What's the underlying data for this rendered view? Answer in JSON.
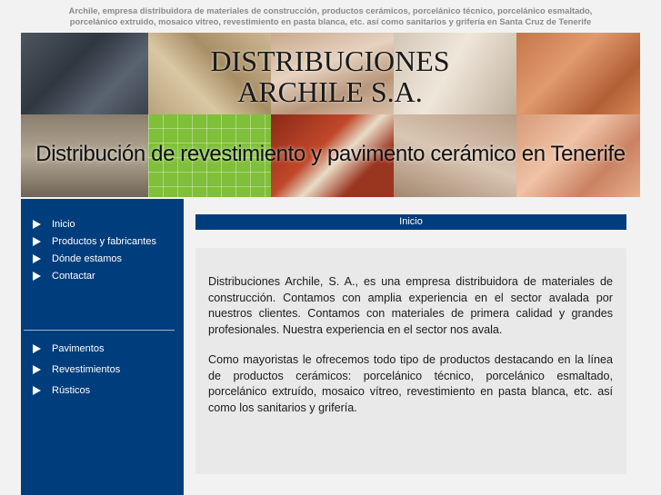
{
  "top_text": {
    "line1": "Archile, empresa distribuidora de materiales de construcción, productos cerámicos, porcelánico técnico, porcelánico esmaltado,",
    "line2": "porcelánico extruido, mosaico vitreo, revestimiento en pasta blanca, etc. así como sanitarios y grifería en Santa Cruz de Tenerife"
  },
  "banner": {
    "title_line1": "DISTRIBUCIONES",
    "title_line2": "ARCHILE S.A.",
    "subtitle": "Distribución de revestimiento y pavimento cerámico en Tenerife"
  },
  "sidebar": {
    "menu1": [
      {
        "label": "Inicio",
        "icon": "arrow-right-icon"
      },
      {
        "label": "Productos y fabricantes",
        "icon": "arrow-right-icon"
      },
      {
        "label": "Dónde estamos",
        "icon": "arrow-right-icon"
      },
      {
        "label": "Contactar",
        "icon": "arrow-right-icon"
      }
    ],
    "menu2": [
      {
        "label": "Pavimentos",
        "icon": "arrow-right-icon"
      },
      {
        "label": "Revestimientos",
        "icon": "arrow-right-icon"
      },
      {
        "label": "Rústicos",
        "icon": "arrow-right-icon"
      }
    ]
  },
  "main": {
    "header": "Inicio",
    "paragraph1": "Distribuciones Archile, S. A., es una empresa distribuidora de materiales de construcción. Contamos con amplia experiencia en el sector avalada por nuestros clientes. Contamos con materiales de primera calidad y grandes profesionales. Nuestra experiencia en el sector nos avala.",
    "paragraph2": "Como mayoristas le ofrecemos todo tipo de productos destacando en la línea de productos cerámicos: porcelánico técnico, porcelánico esmaltado, porcelánico extruído, mosaico vítreo,   revestimiento en pasta blanca, etc. así como los sanitarios y grifería."
  },
  "colors": {
    "nav_blue": "#003d7c",
    "page_bg": "#f2f2f2",
    "content_bg": "#e9e9e9"
  }
}
